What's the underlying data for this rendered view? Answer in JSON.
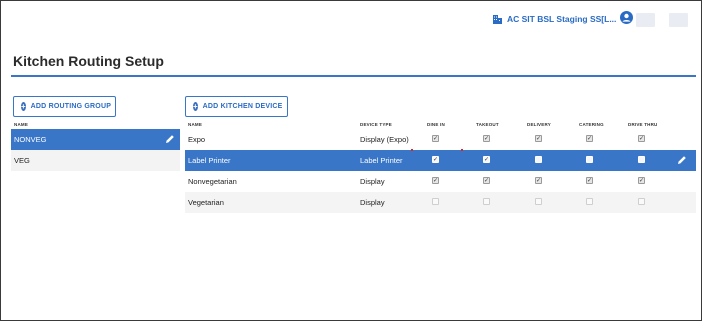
{
  "header": {
    "store_name": "AC SIT BSL Staging SS[L..."
  },
  "page_title": "Kitchen Routing Setup",
  "buttons": {
    "add_routing_group": "ADD ROUTING GROUP",
    "add_kitchen_device": "ADD KITCHEN DEVICE"
  },
  "groups": {
    "column_name": "NAME",
    "items": [
      {
        "name": "NONVEG",
        "selected": true
      },
      {
        "name": "VEG",
        "selected": false
      }
    ]
  },
  "devices": {
    "columns": {
      "name": "NAME",
      "device_type": "DEVICE TYPE",
      "dine_in": "DINE IN",
      "takeout": "TAKEOUT",
      "delivery": "DELIVERY",
      "catering": "CATERING",
      "drive_thru": "DRIVE THRU"
    },
    "rows": [
      {
        "name": "Expo",
        "device_type": "Display (Expo)",
        "dine_in": true,
        "takeout": true,
        "delivery": true,
        "catering": true,
        "drive_thru": true,
        "selected": false
      },
      {
        "name": "Label Printer",
        "device_type": "Label Printer",
        "dine_in": true,
        "takeout": true,
        "delivery": false,
        "catering": false,
        "drive_thru": false,
        "selected": true
      },
      {
        "name": "Nonvegetarian",
        "device_type": "Display",
        "dine_in": true,
        "takeout": true,
        "delivery": true,
        "catering": true,
        "drive_thru": true,
        "selected": false
      },
      {
        "name": "Vegetarian",
        "device_type": "Display",
        "dine_in": false,
        "takeout": false,
        "delivery": false,
        "catering": false,
        "drive_thru": false,
        "selected": false
      }
    ]
  },
  "colors": {
    "accent": "#3a76c8",
    "link": "#2a6bc4"
  }
}
